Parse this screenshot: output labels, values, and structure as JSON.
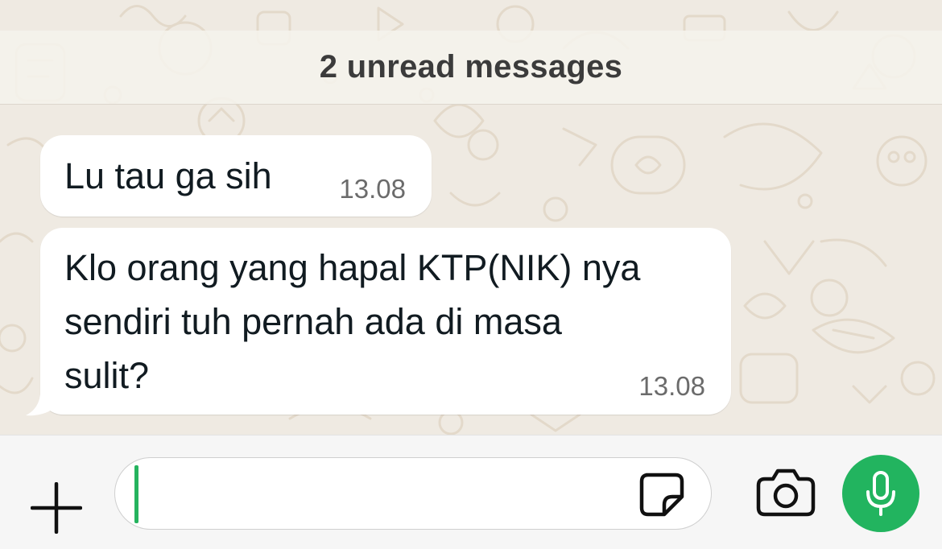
{
  "banner": {
    "text": "2 unread messages"
  },
  "messages": [
    {
      "lines": [
        "Lu tau ga sih"
      ],
      "time": "13.08"
    },
    {
      "lines": [
        "Klo orang yang hapal KTP(NIK) nya",
        "sendiri tuh pernah ada di masa",
        "sulit?"
      ],
      "time": "13.08"
    }
  ],
  "composer": {
    "value": "",
    "placeholder": ""
  },
  "icons": {
    "attach": "plus-icon",
    "sticker": "sticker-icon",
    "camera": "camera-icon",
    "voice": "microphone-icon"
  },
  "colors": {
    "background": "#efeae2",
    "bubble": "#ffffff",
    "accent": "#22b45f",
    "text": "#111b21",
    "timestamp": "#6b6b6b"
  }
}
